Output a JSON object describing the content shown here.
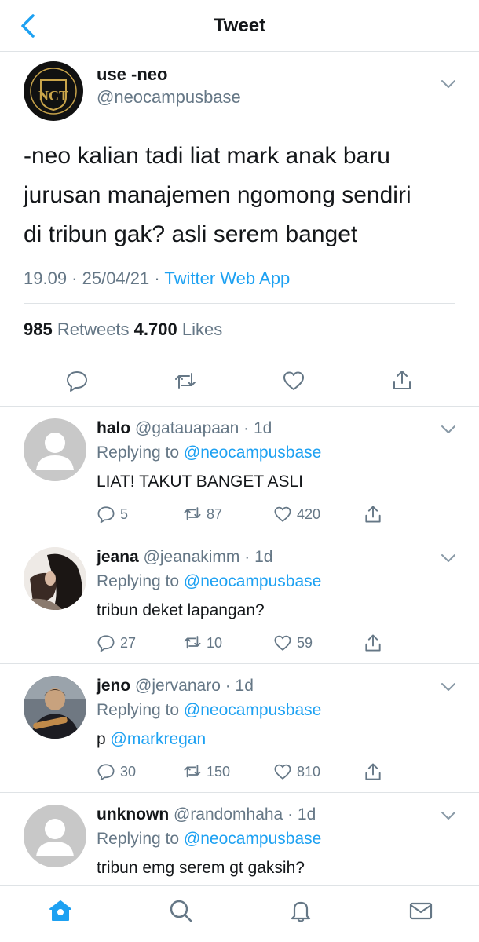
{
  "header": {
    "title": "Tweet"
  },
  "tweet": {
    "name": "use -neo",
    "handle": "@neocampusbase",
    "avatar_logo_text": "NCT",
    "text_lines": [
      "-neo kalian tadi liat mark anak baru",
      "jurusan manajemen ngomong sendiri",
      "di tribun gak? asli serem banget"
    ],
    "time": "19.09 · 25/04/21 · ",
    "source": "Twitter Web App",
    "retweets_count": "985",
    "retweets_label": " Retweets  ",
    "likes_count": "4.700",
    "likes_label": " Likes"
  },
  "replies": [
    {
      "name": "halo",
      "handle": "@gatauapaan",
      "time": " · 1d",
      "replying_prefix": "Replying to ",
      "replying_to": "@neocampusbase",
      "text": "LIAT! TAKUT BANGET ASLI",
      "mention": "",
      "replies": "5",
      "retweets": "87",
      "likes": "420"
    },
    {
      "name": "jeana",
      "handle": "@jeanakimm",
      "time": " · 1d",
      "replying_prefix": "Replying to ",
      "replying_to": "@neocampusbase",
      "text": "tribun deket lapangan?",
      "mention": "",
      "replies": "27",
      "retweets": "10",
      "likes": "59"
    },
    {
      "name": "jeno",
      "handle": "@jervanaro",
      "time": " · 1d",
      "replying_prefix": "Replying to ",
      "replying_to": "@neocampusbase",
      "text": "p ",
      "mention": "@markregan",
      "replies": "30",
      "retweets": "150",
      "likes": "810"
    },
    {
      "name": "unknown",
      "handle": "@randomhaha",
      "time": " · 1d",
      "replying_prefix": "Replying to ",
      "replying_to": "@neocampusbase",
      "text": "tribun emg serem gt gaksih?",
      "mention": ""
    }
  ],
  "icons": {
    "back": "chevron-left-icon",
    "more": "chevron-down-icon",
    "reply": "comment-icon",
    "retweet": "retweet-icon",
    "like": "heart-icon",
    "share": "share-icon",
    "tabs": [
      "home-icon",
      "search-icon",
      "bell-icon",
      "mail-icon"
    ]
  },
  "colors": {
    "accent": "#1da1f2",
    "secondary_text": "#657786",
    "divider": "#dfe3e6"
  }
}
